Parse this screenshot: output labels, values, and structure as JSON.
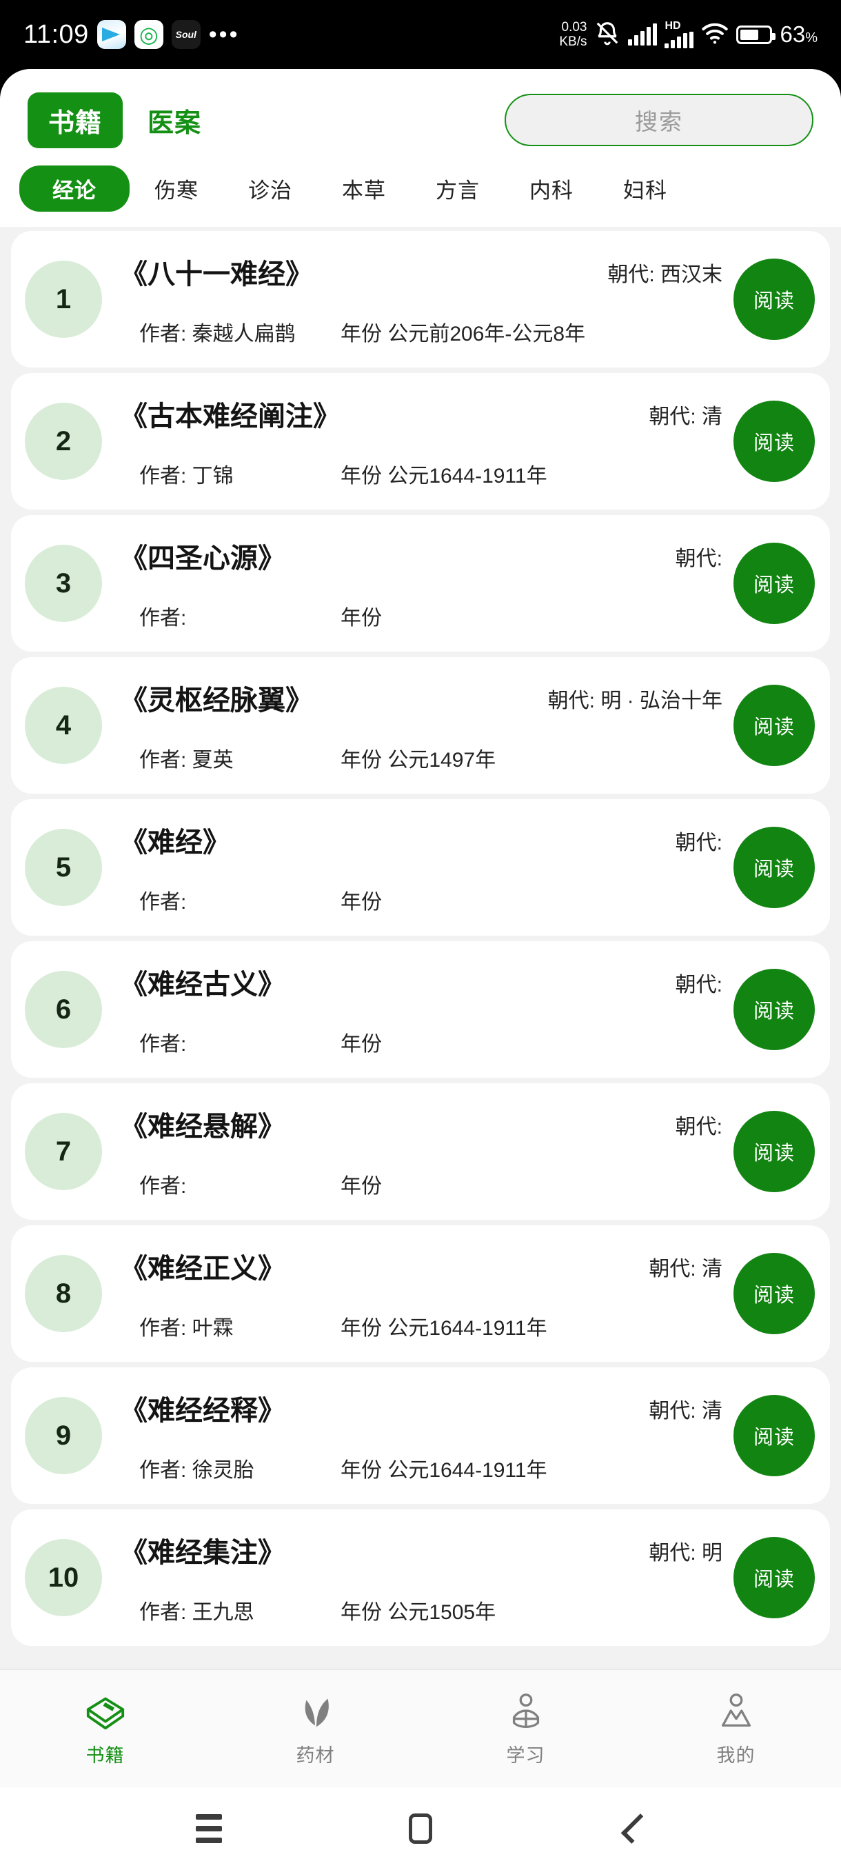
{
  "status_bar": {
    "time": "11:09",
    "app_icons": [
      "telegram-icon",
      "wechat-icon",
      "soul-icon"
    ],
    "soul_label": "Soul",
    "overflow": "•••",
    "net_speed_value": "0.03",
    "net_speed_unit": "KB/s",
    "mute_icon": "bell-mute-icon",
    "signal_icon": "signal-bars-icon",
    "hd_label": "HD",
    "wifi_icon": "wifi-icon",
    "battery_percent": "63",
    "battery_percent_symbol": "%"
  },
  "header": {
    "primary_tab": "书籍",
    "secondary_tab": "医案",
    "search_placeholder": "搜索"
  },
  "categories": [
    {
      "label": "经论",
      "active": true
    },
    {
      "label": "伤寒",
      "active": false
    },
    {
      "label": "诊治",
      "active": false
    },
    {
      "label": "本草",
      "active": false
    },
    {
      "label": "方言",
      "active": false
    },
    {
      "label": "内科",
      "active": false
    },
    {
      "label": "妇科",
      "active": false
    }
  ],
  "labels": {
    "dynasty_prefix": "朝代:",
    "author_prefix": "作者:",
    "year_prefix": "年份",
    "read_button": "阅读"
  },
  "books": [
    {
      "index": "1",
      "title": "《八十一难经》",
      "dynasty": "朝代: 西汉末",
      "author": "作者: 秦越人扁鹊",
      "year": "年份 公元前206年-公元8年",
      "read": "阅读"
    },
    {
      "index": "2",
      "title": "《古本难经阐注》",
      "dynasty": "朝代: 清",
      "author": "作者: 丁锦",
      "year": "年份 公元1644-1911年",
      "read": "阅读"
    },
    {
      "index": "3",
      "title": "《四圣心源》",
      "dynasty": "朝代:",
      "author": "作者:",
      "year": "年份",
      "read": "阅读"
    },
    {
      "index": "4",
      "title": "《灵枢经脉翼》",
      "dynasty": "朝代: 明 · 弘治十年",
      "author": "作者: 夏英",
      "year": "年份 公元1497年",
      "read": "阅读"
    },
    {
      "index": "5",
      "title": "《难经》",
      "dynasty": "朝代:",
      "author": "作者:",
      "year": "年份",
      "read": "阅读"
    },
    {
      "index": "6",
      "title": "《难经古义》",
      "dynasty": "朝代:",
      "author": "作者:",
      "year": "年份",
      "read": "阅读"
    },
    {
      "index": "7",
      "title": "《难经悬解》",
      "dynasty": "朝代:",
      "author": "作者:",
      "year": "年份",
      "read": "阅读"
    },
    {
      "index": "8",
      "title": "《难经正义》",
      "dynasty": "朝代: 清",
      "author": "作者: 叶霖",
      "year": "年份 公元1644-1911年",
      "read": "阅读"
    },
    {
      "index": "9",
      "title": "《难经经释》",
      "dynasty": "朝代: 清",
      "author": "作者: 徐灵胎",
      "year": "年份 公元1644-1911年",
      "read": "阅读"
    },
    {
      "index": "10",
      "title": "《难经集注》",
      "dynasty": "朝代: 明",
      "author": "作者: 王九思",
      "year": "年份 公元1505年",
      "read": "阅读"
    }
  ],
  "bottom_nav": [
    {
      "label": "书籍",
      "icon": "book-icon",
      "active": true
    },
    {
      "label": "药材",
      "icon": "leaf-icon",
      "active": false
    },
    {
      "label": "学习",
      "icon": "study-icon",
      "active": false
    },
    {
      "label": "我的",
      "icon": "person-icon",
      "active": false
    }
  ],
  "android_nav": {
    "recents": "recents-icon",
    "home": "home-icon",
    "back": "back-icon"
  },
  "colors": {
    "brand_green": "#149014",
    "button_green": "#128412",
    "badge_green": "#d8ecd8",
    "page_bg": "#f2f2f2",
    "card_bg": "#ffffff",
    "muted_text": "#808080"
  }
}
